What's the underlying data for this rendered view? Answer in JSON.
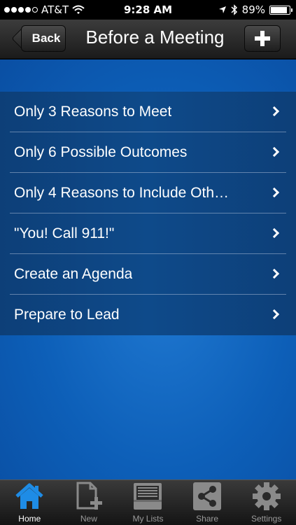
{
  "status_bar": {
    "carrier": "AT&T",
    "time": "9:28 AM",
    "battery": "89%",
    "battery_level": 0.89
  },
  "nav": {
    "back_label": "Back",
    "title": "Before a Meeting"
  },
  "list": {
    "items": [
      {
        "label": "Only 3 Reasons to Meet"
      },
      {
        "label": "Only 6 Possible Outcomes"
      },
      {
        "label": "Only 4 Reasons to Include Oth…"
      },
      {
        "label": "\"You! Call 911!\""
      },
      {
        "label": "Create an Agenda"
      },
      {
        "label": "Prepare to Lead"
      }
    ]
  },
  "tabs": [
    {
      "label": "Home",
      "icon": "home-icon",
      "active": true
    },
    {
      "label": "New",
      "icon": "new-document-icon",
      "active": false
    },
    {
      "label": "My Lists",
      "icon": "my-lists-icon",
      "active": false
    },
    {
      "label": "Share",
      "icon": "share-icon",
      "active": false
    },
    {
      "label": "Settings",
      "icon": "gear-icon",
      "active": false
    }
  ],
  "colors": {
    "accent_blue": "#1e8ce6",
    "background_blue": "#0d5fb8",
    "list_background": "#0e4a8a"
  }
}
